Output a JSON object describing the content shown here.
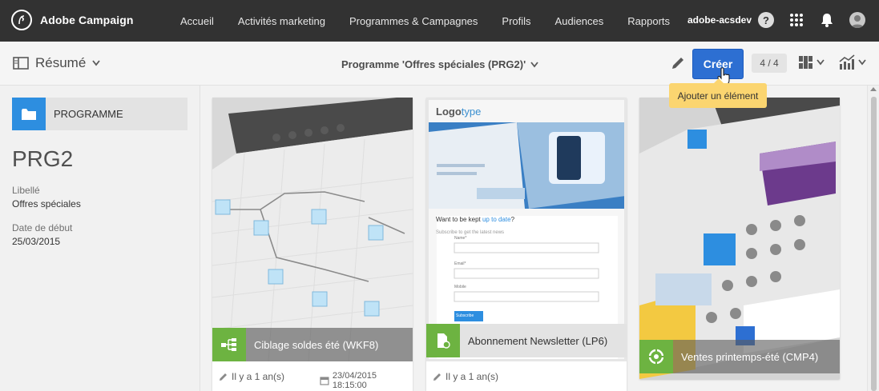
{
  "app": {
    "title": "Adobe Campaign"
  },
  "nav": [
    "Accueil",
    "Activités marketing",
    "Programmes & Campagnes",
    "Profils",
    "Audiences",
    "Rapports"
  ],
  "user": "adobe-acsdev",
  "help_label": "?",
  "subheader": {
    "view_label": "Résumé",
    "page_title": "Programme 'Offres spéciales (PRG2)'",
    "create_label": "Créer",
    "counter": "4 / 4",
    "tooltip": "Ajouter un élément"
  },
  "sidebar": {
    "type_label": "PROGRAMME",
    "name": "PRG2",
    "fields": [
      {
        "label": "Libellé",
        "value": "Offres spéciales"
      },
      {
        "label": "Date de début",
        "value": "25/03/2015"
      }
    ]
  },
  "cards": [
    {
      "title": "Ciblage soldes été (WKF8)",
      "modified": "Il y a 1 an(s)",
      "date": "23/04/2015 18:15:00"
    },
    {
      "title": "Abonnement Newsletter (LP6)",
      "modified": "Il y a 1 an(s)",
      "preview": {
        "logo_a": "Logo",
        "logo_b": "type",
        "heading_a": "Want to be kept ",
        "heading_b": "up to date",
        "heading_c": "?",
        "sub": "Subscribe to get the latest news",
        "field_name": "Name*",
        "field_email": "Email*",
        "field_mobile": "Mobile",
        "button": "Subscribe"
      }
    },
    {
      "title": "Ventes printemps-été (CMP4)"
    }
  ],
  "colors": {
    "accent": "#2d6fd2",
    "green": "#6db341",
    "folder": "#2d8ee0",
    "tooltip": "#fbd570"
  }
}
